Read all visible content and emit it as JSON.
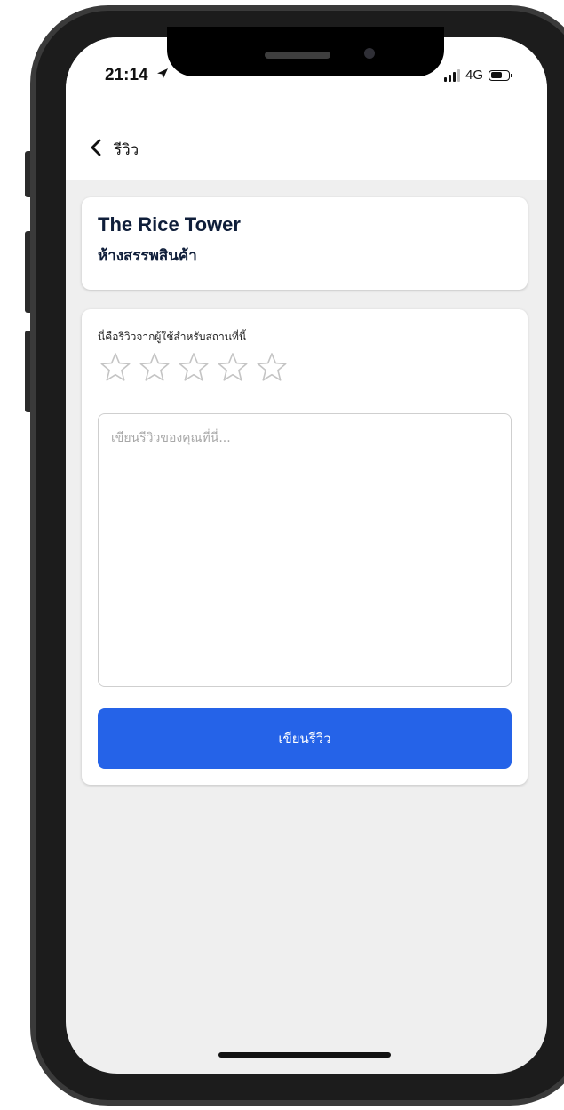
{
  "status_bar": {
    "time": "21:14",
    "network": "4G",
    "icons": [
      "location-arrow-icon",
      "signal-icon",
      "battery-icon"
    ]
  },
  "nav": {
    "back_icon": "chevron-left-icon",
    "title": "รีวิว"
  },
  "place": {
    "name": "The Rice Tower",
    "category": "ห้างสรรพสินค้า"
  },
  "review": {
    "prompt": "นี่คือรีวิวจากผู้ใช้สำหรับสถานที่นี้",
    "rating": 0,
    "max_rating": 5,
    "star_icon": "star-outline-icon",
    "input_value": "",
    "input_placeholder": "เขียนรีวิวของคุณที่นี่...",
    "submit_label": "เขียนรีวิว"
  },
  "colors": {
    "primary": "#2563e8",
    "background": "#efefef",
    "text_dark": "#0f1e3a",
    "star_outline": "#c4c4c4"
  }
}
